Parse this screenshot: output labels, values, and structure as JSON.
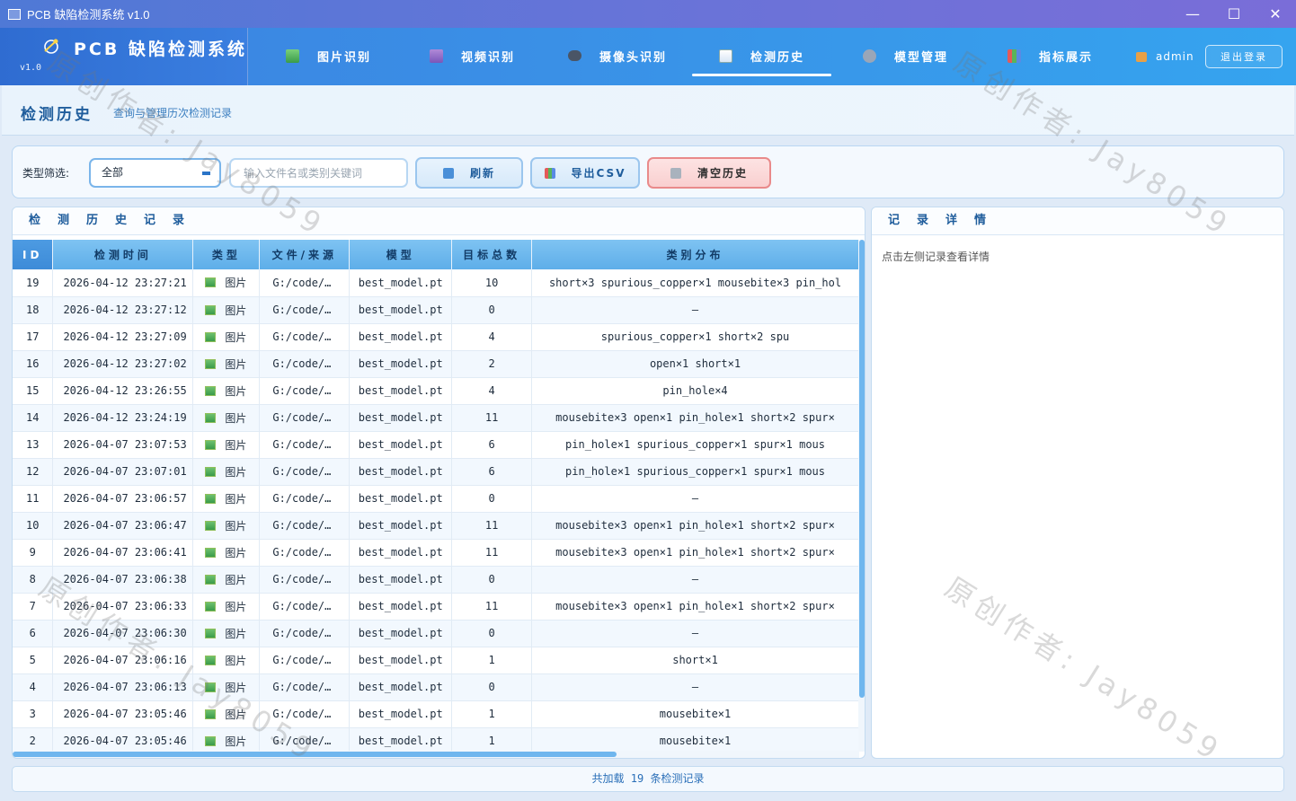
{
  "window": {
    "title": "PCB 缺陷检测系统 v1.0",
    "controls": {
      "minimize": "—",
      "maximize": "☐",
      "close": "✕"
    }
  },
  "brand": {
    "name": "PCB 缺陷检测系统",
    "version": "v1.0"
  },
  "nav": {
    "items": [
      {
        "label": "图片识别",
        "icon": "image-icon"
      },
      {
        "label": "视频识别",
        "icon": "video-icon"
      },
      {
        "label": "摄像头识别",
        "icon": "camera-icon"
      },
      {
        "label": "检测历史",
        "icon": "history-icon"
      },
      {
        "label": "模型管理",
        "icon": "gear-icon"
      },
      {
        "label": "指标展示",
        "icon": "chart-icon"
      }
    ],
    "active": "检测历史",
    "user": "admin",
    "logout_label": "退出登录"
  },
  "page": {
    "title": "检测历史",
    "subtitle": "查询与管理历次检测记录"
  },
  "filter": {
    "label": "类型筛选:",
    "selected": "全部",
    "search_placeholder": "输入文件名或类别关键词",
    "refresh_label": "刷新",
    "export_label": "导出CSV",
    "clear_label": "清空历史"
  },
  "records_panel": {
    "title": "检测历史记录",
    "columns": [
      "ID",
      "检测时间",
      "类型",
      "文件/来源",
      "模型",
      "目标总数",
      "类别分布"
    ],
    "rows": [
      {
        "id": "19",
        "time": "2026-04-12 23:27:21",
        "type": "图片",
        "source": "G:/code/…",
        "model": "best_model.pt",
        "total": "10",
        "dist": "short×3  spurious_copper×1  mousebite×3  pin_hol"
      },
      {
        "id": "18",
        "time": "2026-04-12 23:27:12",
        "type": "图片",
        "source": "G:/code/…",
        "model": "best_model.pt",
        "total": "0",
        "dist": "—"
      },
      {
        "id": "17",
        "time": "2026-04-12 23:27:09",
        "type": "图片",
        "source": "G:/code/…",
        "model": "best_model.pt",
        "total": "4",
        "dist": "spurious_copper×1  short×2  spu"
      },
      {
        "id": "16",
        "time": "2026-04-12 23:27:02",
        "type": "图片",
        "source": "G:/code/…",
        "model": "best_model.pt",
        "total": "2",
        "dist": "open×1  short×1"
      },
      {
        "id": "15",
        "time": "2026-04-12 23:26:55",
        "type": "图片",
        "source": "G:/code/…",
        "model": "best_model.pt",
        "total": "4",
        "dist": "pin_hole×4"
      },
      {
        "id": "14",
        "time": "2026-04-12 23:24:19",
        "type": "图片",
        "source": "G:/code/…",
        "model": "best_model.pt",
        "total": "11",
        "dist": "mousebite×3  open×1  pin_hole×1  short×2  spur×"
      },
      {
        "id": "13",
        "time": "2026-04-07 23:07:53",
        "type": "图片",
        "source": "G:/code/…",
        "model": "best_model.pt",
        "total": "6",
        "dist": "pin_hole×1  spurious_copper×1  spur×1  mous"
      },
      {
        "id": "12",
        "time": "2026-04-07 23:07:01",
        "type": "图片",
        "source": "G:/code/…",
        "model": "best_model.pt",
        "total": "6",
        "dist": "pin_hole×1  spurious_copper×1  spur×1  mous"
      },
      {
        "id": "11",
        "time": "2026-04-07 23:06:57",
        "type": "图片",
        "source": "G:/code/…",
        "model": "best_model.pt",
        "total": "0",
        "dist": "—"
      },
      {
        "id": "10",
        "time": "2026-04-07 23:06:47",
        "type": "图片",
        "source": "G:/code/…",
        "model": "best_model.pt",
        "total": "11",
        "dist": "mousebite×3  open×1  pin_hole×1  short×2  spur×"
      },
      {
        "id": "9",
        "time": "2026-04-07 23:06:41",
        "type": "图片",
        "source": "G:/code/…",
        "model": "best_model.pt",
        "total": "11",
        "dist": "mousebite×3  open×1  pin_hole×1  short×2  spur×"
      },
      {
        "id": "8",
        "time": "2026-04-07 23:06:38",
        "type": "图片",
        "source": "G:/code/…",
        "model": "best_model.pt",
        "total": "0",
        "dist": "—"
      },
      {
        "id": "7",
        "time": "2026-04-07 23:06:33",
        "type": "图片",
        "source": "G:/code/…",
        "model": "best_model.pt",
        "total": "11",
        "dist": "mousebite×3  open×1  pin_hole×1  short×2  spur×"
      },
      {
        "id": "6",
        "time": "2026-04-07 23:06:30",
        "type": "图片",
        "source": "G:/code/…",
        "model": "best_model.pt",
        "total": "0",
        "dist": "—"
      },
      {
        "id": "5",
        "time": "2026-04-07 23:06:16",
        "type": "图片",
        "source": "G:/code/…",
        "model": "best_model.pt",
        "total": "1",
        "dist": "short×1"
      },
      {
        "id": "4",
        "time": "2026-04-07 23:06:13",
        "type": "图片",
        "source": "G:/code/…",
        "model": "best_model.pt",
        "total": "0",
        "dist": "—"
      },
      {
        "id": "3",
        "time": "2026-04-07 23:05:46",
        "type": "图片",
        "source": "G:/code/…",
        "model": "best_model.pt",
        "total": "1",
        "dist": "mousebite×1"
      },
      {
        "id": "2",
        "time": "2026-04-07 23:05:46",
        "type": "图片",
        "source": "G:/code/…",
        "model": "best_model.pt",
        "total": "1",
        "dist": "mousebite×1"
      }
    ]
  },
  "detail_panel": {
    "title": "记录详情",
    "hint": "点击左侧记录查看详情"
  },
  "footer": {
    "status": "共加载 19 条检测记录"
  },
  "watermark": "原创作者: Jay8059",
  "colors": {
    "accent": "#3a8fe6",
    "brand_dark": "#2f6cd1",
    "header_blue": "#5eaee9",
    "danger": "#e98a8a"
  }
}
